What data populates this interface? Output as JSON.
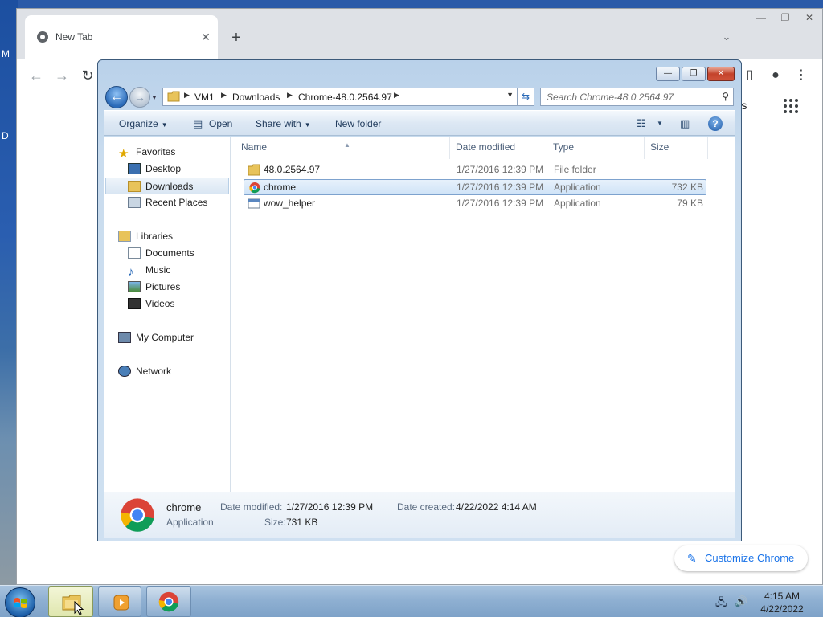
{
  "desktop": {
    "edge_letters": [
      "M",
      "D"
    ]
  },
  "chrome": {
    "tab_title": "New Tab",
    "tab_close": "✕",
    "new_tab": "+",
    "tab_search": "⌄",
    "images_link": "ages",
    "customize_label": "Customize Chrome",
    "window_controls": [
      "—",
      "❐",
      "✕"
    ]
  },
  "explorer": {
    "window_controls": [
      "—",
      "❐",
      "✕"
    ],
    "breadcrumb": [
      "VM1",
      "Downloads",
      "Chrome-48.0.2564.97"
    ],
    "search_placeholder": "Search Chrome-48.0.2564.97",
    "commands": {
      "organize": "Organize",
      "open": "Open",
      "share_with": "Share with",
      "new_folder": "New folder"
    },
    "nav": {
      "favorites": "Favorites",
      "favorites_items": [
        "Desktop",
        "Downloads",
        "Recent Places"
      ],
      "libraries": "Libraries",
      "libraries_items": [
        "Documents",
        "Music",
        "Pictures",
        "Videos"
      ],
      "computer": "My Computer",
      "network": "Network"
    },
    "columns": [
      "Name",
      "Date modified",
      "Type",
      "Size"
    ],
    "files": [
      {
        "name": "48.0.2564.97",
        "date": "1/27/2016 12:39 PM",
        "type": "File folder",
        "size": ""
      },
      {
        "name": "chrome",
        "date": "1/27/2016 12:39 PM",
        "type": "Application",
        "size": "732 KB"
      },
      {
        "name": "wow_helper",
        "date": "1/27/2016 12:39 PM",
        "type": "Application",
        "size": "79 KB"
      }
    ],
    "details": {
      "name": "chrome",
      "kind": "Application",
      "date_modified_label": "Date modified:",
      "date_modified": "1/27/2016 12:39 PM",
      "size_label": "Size:",
      "size": "731 KB",
      "date_created_label": "Date created:",
      "date_created": "4/22/2022 4:14 AM"
    }
  },
  "taskbar": {
    "time": "4:15 AM",
    "date": "4/22/2022"
  },
  "colors": {
    "accent": "#1a73e8",
    "selection": "#cfe3f7",
    "taskbar": "#8fb0d2"
  }
}
